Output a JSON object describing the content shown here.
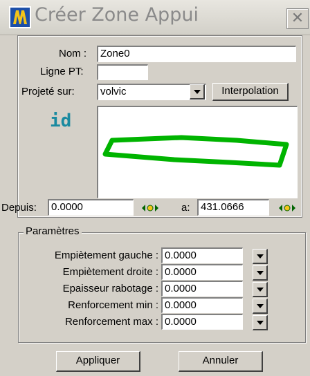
{
  "window": {
    "title": "Créer Zone Appui",
    "close_label": "✕"
  },
  "form": {
    "nom_label": "Nom :",
    "nom_value": "Zone0",
    "ligne_label": "Ligne PT:",
    "ligne_value": "",
    "projete_label": "Projeté sur:",
    "projete_value": "volvic",
    "interpolation_label": "Interpolation",
    "id_label": "id",
    "depuis_label": "Depuis:",
    "depuis_value": "0.0000",
    "a_label": "a:",
    "a_value": "431.0666"
  },
  "parametres": {
    "title": "Paramètres",
    "rows": [
      {
        "label": "Empiètement gauche :",
        "value": "0.0000"
      },
      {
        "label": "Empiètement droite :",
        "value": "0.0000"
      },
      {
        "label": "Epaisseur rabotage :",
        "value": "0.0000"
      },
      {
        "label": "Renforcement min :",
        "value": "0.0000"
      },
      {
        "label": "Renforcement max :",
        "value": "0.0000"
      }
    ]
  },
  "actions": {
    "apply_label": "Appliquer",
    "cancel_label": "Annuler"
  },
  "colors": {
    "shape_stroke": "#00b400",
    "id_color": "#1a8aa0",
    "dialog_bg": "#d4d0c8"
  },
  "icons": {
    "app": "app-logo-icon",
    "close": "close-icon",
    "dropdown": "chevron-down-icon",
    "arrows": "double-arrow-icon"
  }
}
